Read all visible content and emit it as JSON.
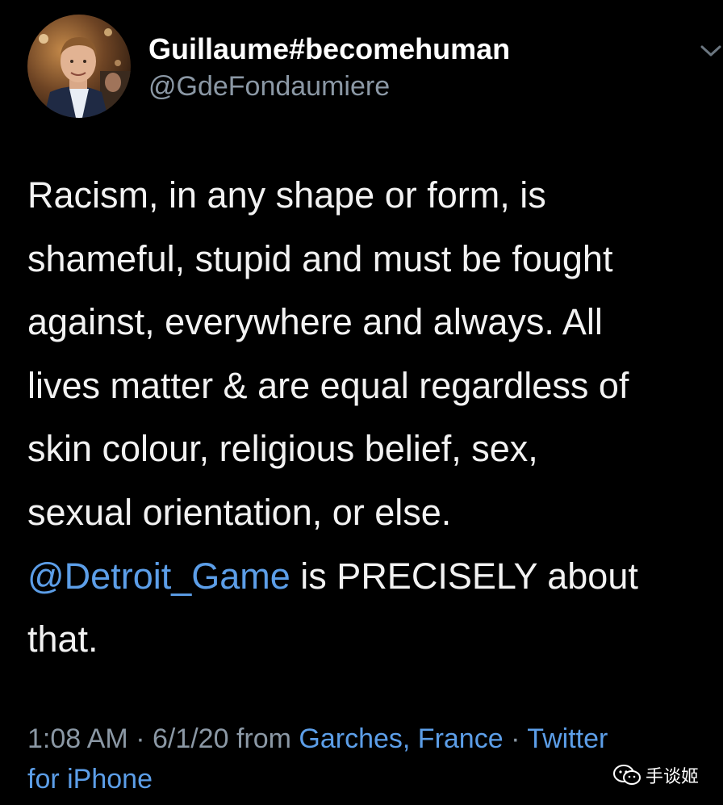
{
  "user": {
    "display_name": "Guillaume#becomehuman",
    "handle": "@GdeFondaumiere"
  },
  "tweet": {
    "lines": [
      "Racism, in any shape or form, is",
      "shameful, stupid and must be fought",
      "against, everywhere and always. All",
      "lives matter & are equal regardless of",
      "skin colour, religious belief, sex,",
      "sexual orientation, or else."
    ],
    "mention": "@Detroit_Game",
    "after_mention": " is PRECISELY about",
    "last_line": "that."
  },
  "meta": {
    "time": "1:08 AM",
    "separator": " · ",
    "date": "6/1/20",
    "from_label": " from ",
    "location": "Garches, France",
    "separator2": " · ",
    "source_part1": "Twitter",
    "source_part2": "for iPhone"
  },
  "watermark": {
    "text": "手谈姬",
    "icon": "wechat-icon"
  },
  "icons": {
    "caret": "chevron-down-icon"
  },
  "colors": {
    "background": "#000000",
    "link": "#5c9ee8",
    "secondary_text": "#8b98a5",
    "primary_text": "#f2f2f2"
  }
}
